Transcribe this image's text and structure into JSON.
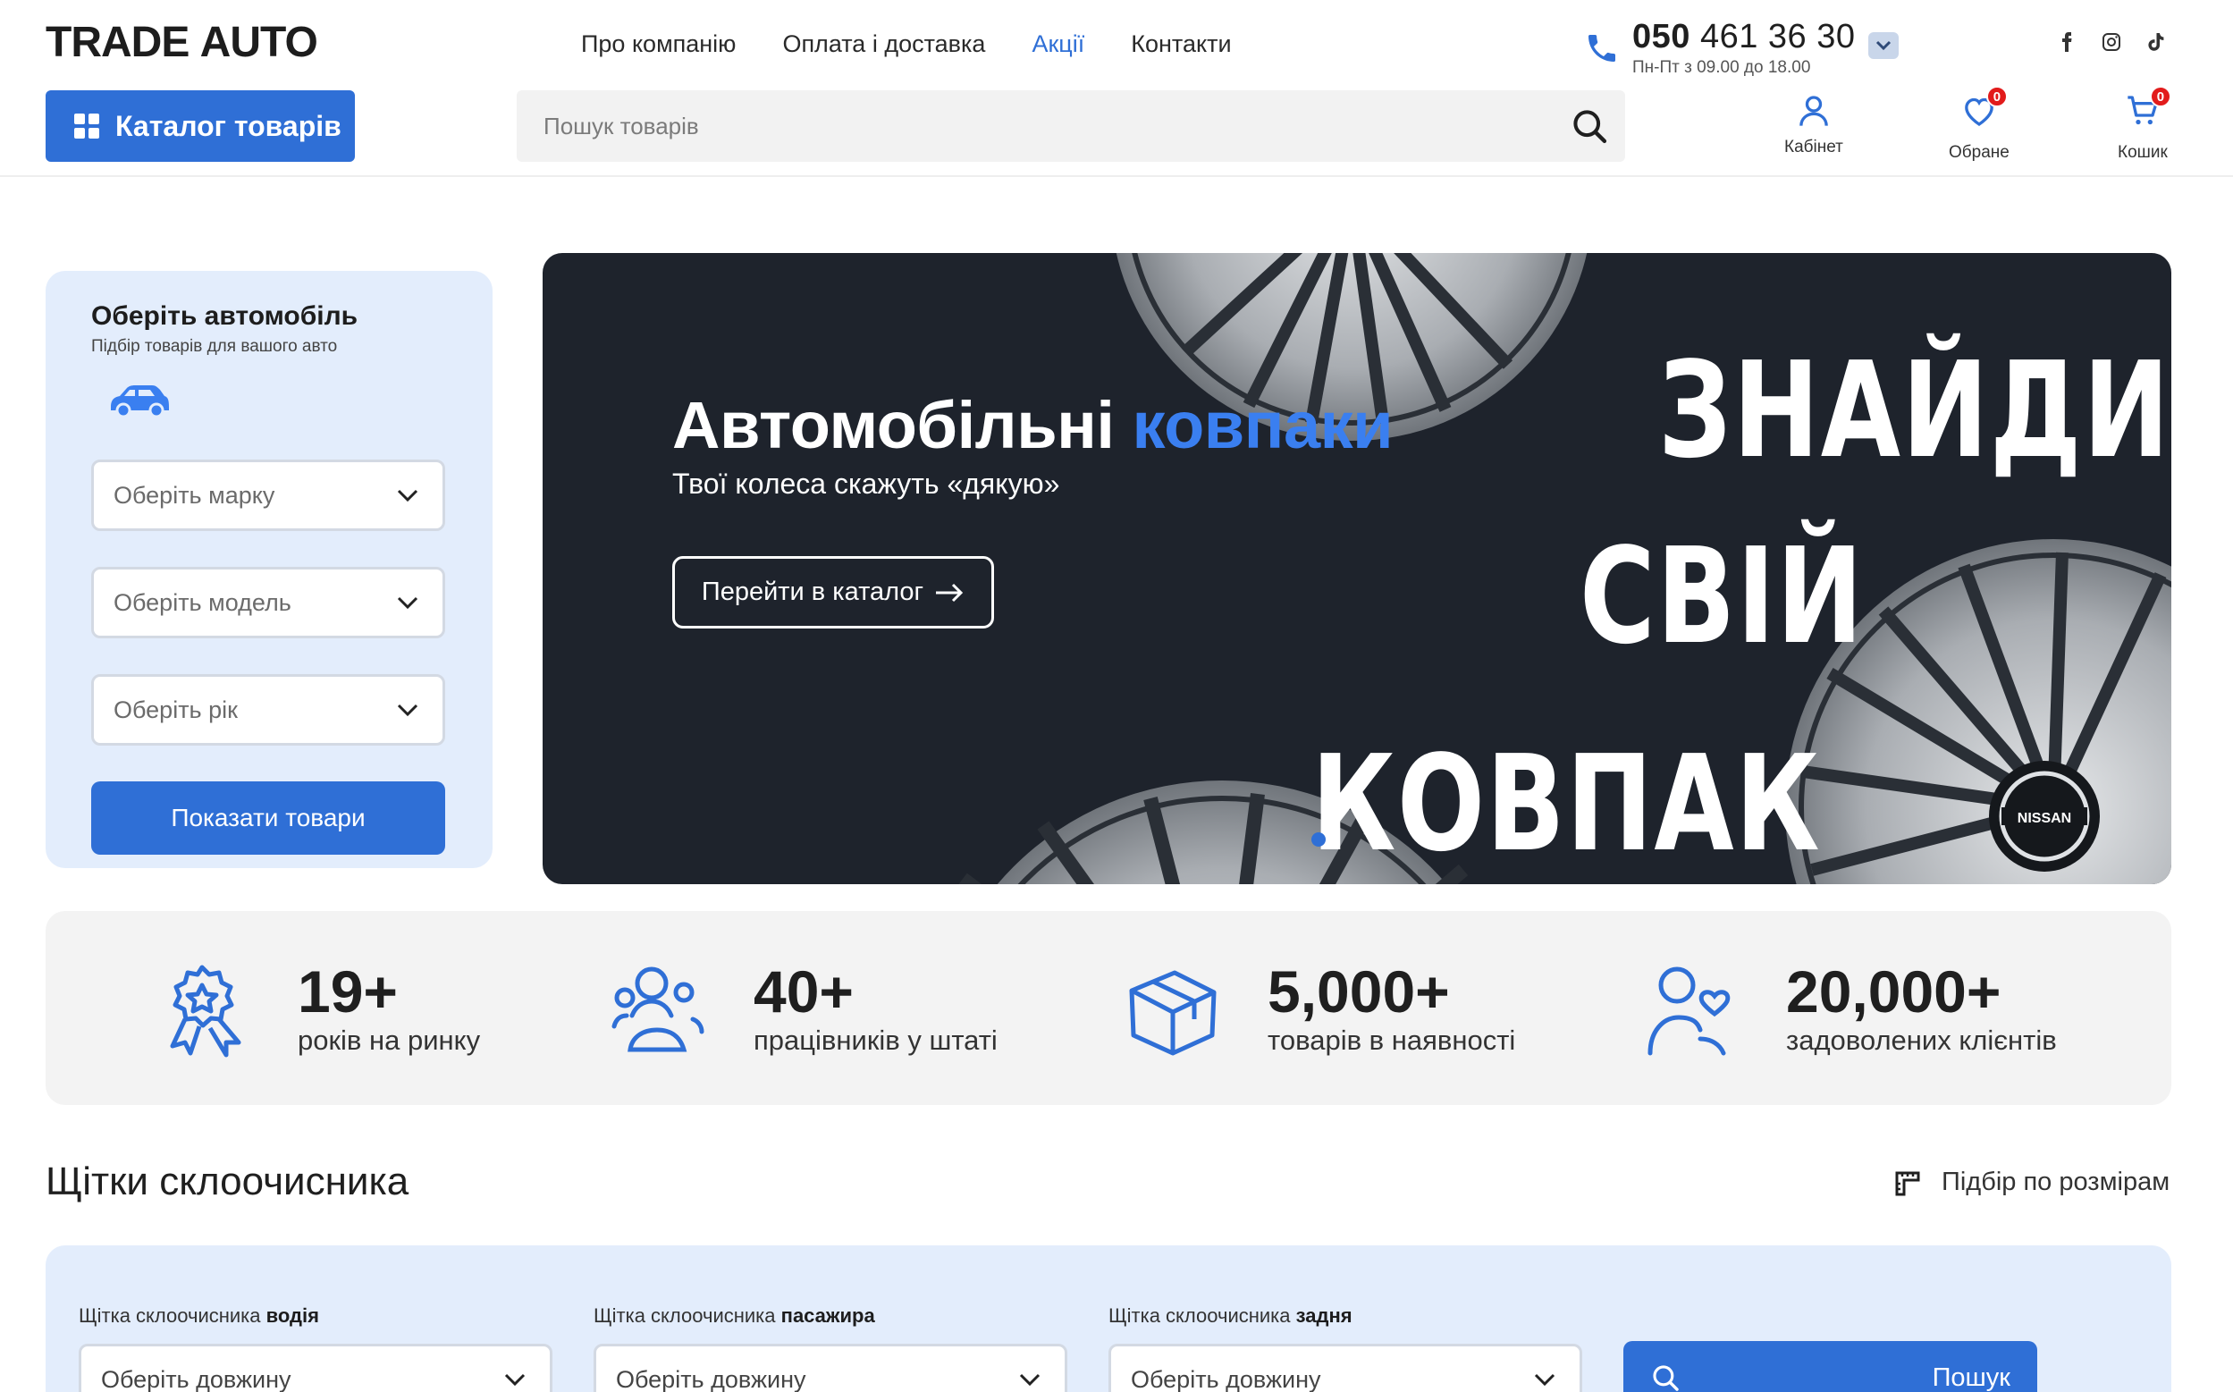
{
  "header": {
    "logo": {
      "part1": "TRADE",
      "part2": "AUTO"
    },
    "nav": [
      {
        "label": "Про компанію",
        "active": false
      },
      {
        "label": "Оплата і доставка",
        "active": false
      },
      {
        "label": "Акції",
        "active": true
      },
      {
        "label": "Контакти",
        "active": false
      }
    ],
    "phone": {
      "code": "050",
      "number": "461 36 30",
      "hours": "Пн-Пт з 09.00 до 18.00"
    },
    "socials": [
      "facebook-icon",
      "instagram-icon",
      "tiktok-icon"
    ],
    "catalog_button": "Каталог товарів",
    "search_placeholder": "Пошук товарів",
    "actions": {
      "cabinet": "Кабінет",
      "favorites": "Обране",
      "favorites_count": "0",
      "cart": "Кошик",
      "cart_count": "0"
    }
  },
  "car_selector": {
    "title": "Оберіть автомобіль",
    "subtitle": "Підбір товарів для вашого авто",
    "brand_placeholder": "Оберіть марку",
    "model_placeholder": "Оберіть модель",
    "year_placeholder": "Оберіть рік",
    "button": "Показати товари"
  },
  "banner": {
    "title_part1": "Автомобільні",
    "title_part2": "ковпаки",
    "subtitle": "Твої колеса скажуть «дякую»",
    "button": "Перейти в каталог",
    "big_words": [
      "ЗНАЙДИ",
      "СВІЙ",
      "КОВПАК"
    ],
    "wheel_brand": "NISSAN"
  },
  "stats": [
    {
      "value": "19+",
      "label": "років на ринку",
      "icon": "award-icon"
    },
    {
      "value": "40+",
      "label": "працівників у штаті",
      "icon": "team-icon"
    },
    {
      "value": "5,000+",
      "label": "товарів в наявності",
      "icon": "box-icon"
    },
    {
      "value": "20,000+",
      "label": "задоволених клієнтів",
      "icon": "happy-clients-icon"
    }
  ],
  "wipers": {
    "title": "Щітки склоочисника",
    "size_link": "Підбір по розмірам",
    "label_prefix": "Щітка склоочисника",
    "columns": [
      {
        "bold": "водія",
        "placeholder": "Оберіть довжину"
      },
      {
        "bold": "пасажира",
        "placeholder": "Оберіть довжину"
      },
      {
        "bold": "задня",
        "placeholder": "Оберіть довжину"
      }
    ],
    "search_button": "Пошук"
  },
  "colors": {
    "accent": "#2f6fd6",
    "banner_bg": "#1e232c",
    "panel_bg": "#e3edfc",
    "badge": "#e21b1b"
  }
}
